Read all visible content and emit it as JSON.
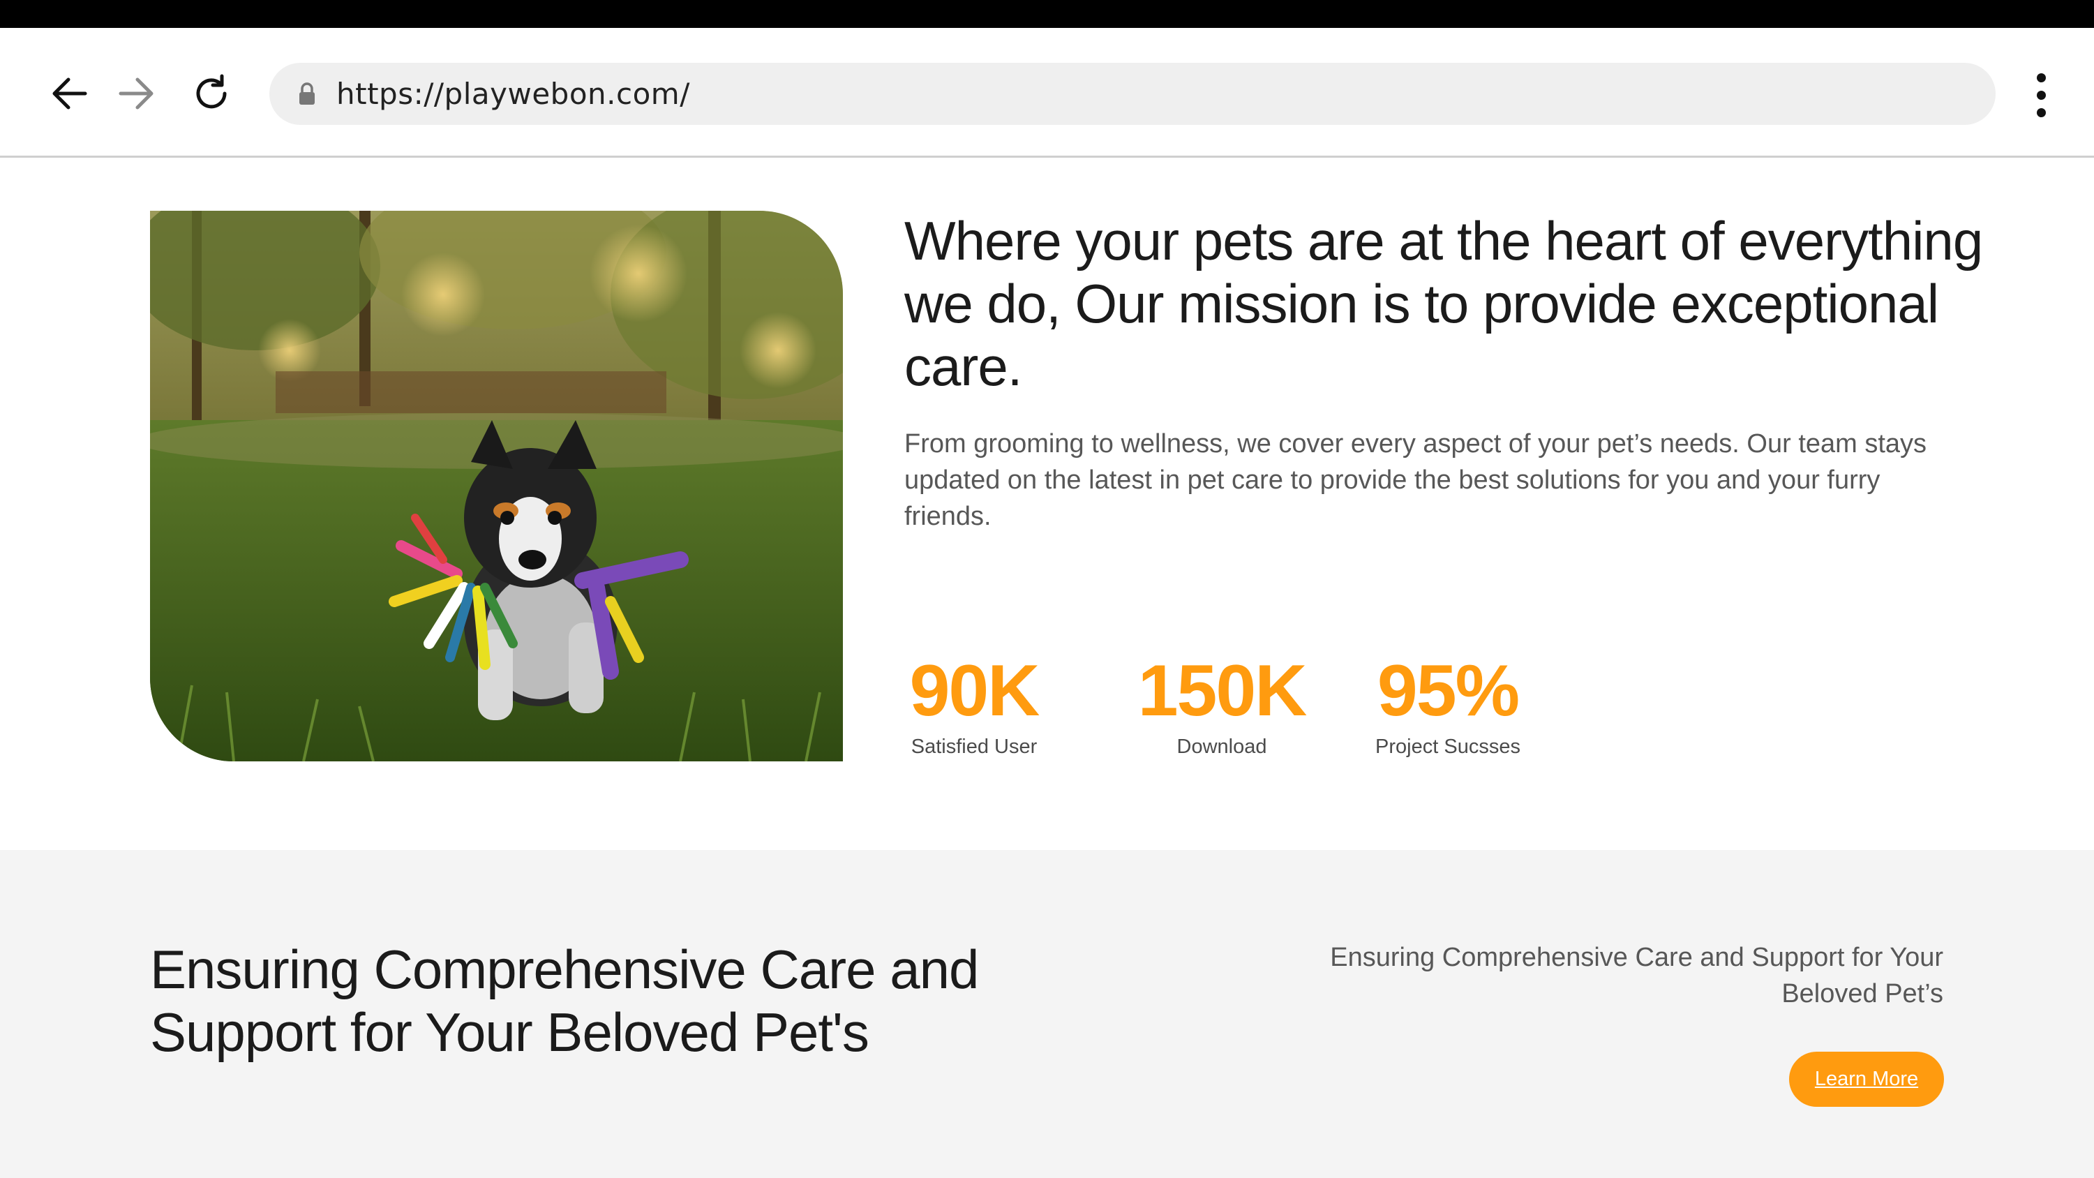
{
  "browser": {
    "url": "https://playwebon.com/"
  },
  "hero": {
    "heading": "Where your pets are at the heart of everything we do, Our mission is to provide exceptional care.",
    "body": "From grooming to wellness, we cover every aspect of your pet’s needs. Our team stays updated on the latest in pet care to provide the best solutions for you and your furry friends.",
    "image_icon": "puppy-photo",
    "stats": [
      {
        "value": "90K",
        "label": "Satisfied User"
      },
      {
        "value": "150K",
        "label": "Download"
      },
      {
        "value": "95%",
        "label": "Project Sucsses"
      }
    ]
  },
  "care": {
    "heading": "Ensuring Comprehensive Care and Support for Your Beloved Pet's",
    "subtext": "Ensuring Comprehensive Care and Support for Your Beloved Pet’s",
    "button_label": "Learn More"
  },
  "colors": {
    "accent": "#ff9b0f",
    "heading": "#1b1b1b",
    "body": "#575757",
    "section_bg": "#f4f4f4"
  }
}
